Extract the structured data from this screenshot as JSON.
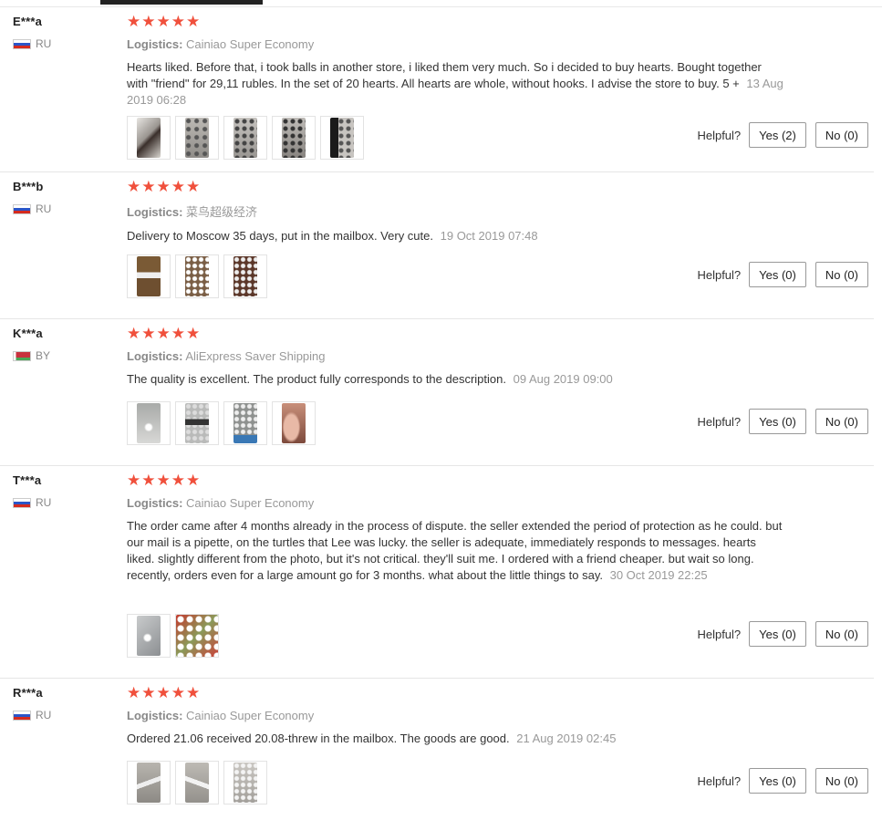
{
  "reviews": [
    {
      "name": "E***a",
      "country": "RU",
      "stars": "★★★★★",
      "logistics_label": "Logistics:",
      "logistics": "Cainiao Super Economy",
      "text": "Hearts liked. Before that, i took balls in another store, i liked them very much. So i decided to buy hearts. Bought together with \"friend\" for 29,11 rubles. In the set of 20 hearts. All hearts are whole, without hooks. I advise the store to buy. 5 +",
      "date": "13 Aug 2019 06:28",
      "photo_count": 5,
      "helpful_label": "Helpful?",
      "yes": "Yes (2)",
      "no": "No (0)"
    },
    {
      "name": "B***b",
      "country": "RU",
      "stars": "★★★★★",
      "logistics_label": "Logistics:",
      "logistics": "菜鸟超级经济",
      "text": "Delivery to Moscow 35 days, put in the mailbox. Very cute.",
      "date": "19 Oct 2019 07:48",
      "photo_count": 3,
      "helpful_label": "Helpful?",
      "yes": "Yes (0)",
      "no": "No (0)"
    },
    {
      "name": "K***a",
      "country": "BY",
      "stars": "★★★★★",
      "logistics_label": "Logistics:",
      "logistics": "AliExpress Saver Shipping",
      "text": "The quality is excellent. The product fully corresponds to the description.",
      "date": "09 Aug 2019 09:00",
      "photo_count": 4,
      "helpful_label": "Helpful?",
      "yes": "Yes (0)",
      "no": "No (0)"
    },
    {
      "name": "T***a",
      "country": "RU",
      "stars": "★★★★★",
      "logistics_label": "Logistics:",
      "logistics": "Cainiao Super Economy",
      "text": "The order came after 4 months already in the process of dispute. the seller extended the period of protection as he could. but our mail is a pipette, on the turtles that Lee was lucky. the seller is adequate, immediately responds to messages. hearts liked. slightly different from the photo, but it's not critical. they'll suit me. I ordered with a friend cheaper. but wait so long. recently, orders even for a large amount go for 3 months. what about the little things to say.",
      "date": "30 Oct 2019 22:25",
      "photo_count": 2,
      "helpful_label": "Helpful?",
      "yes": "Yes (0)",
      "no": "No (0)"
    },
    {
      "name": "R***a",
      "country": "RU",
      "stars": "★★★★★",
      "logistics_label": "Logistics:",
      "logistics": "Cainiao Super Economy",
      "text": "Ordered 21.06 received 20.08-threw in the mailbox. The goods are good.",
      "date": "21 Aug 2019 02:45",
      "photo_count": 3,
      "helpful_label": "Helpful?",
      "yes": "Yes (0)",
      "no": "No (0)"
    }
  ]
}
